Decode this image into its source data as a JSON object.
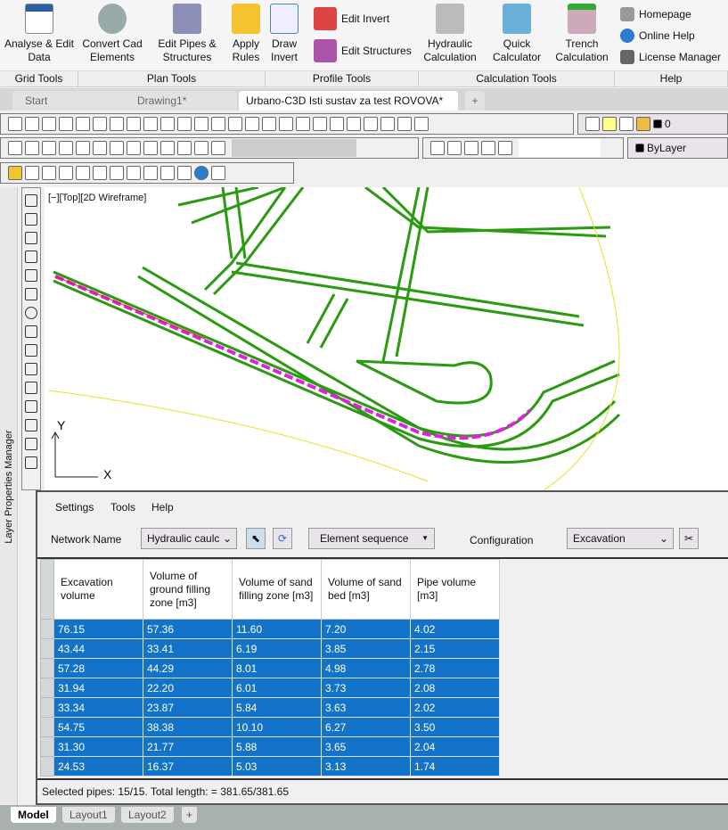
{
  "ribbon": {
    "buttons": [
      {
        "label": "Analyse & Edit Data",
        "icon": "grid-edit-icon"
      },
      {
        "label": "Convert Cad Elements",
        "icon": "pipe-convert-icon"
      },
      {
        "label": "Edit Pipes & Structures",
        "icon": "toolbox-icon"
      },
      {
        "label": "Apply Rules",
        "icon": "rules-lightning-icon"
      },
      {
        "label": "Draw Invert",
        "icon": "draw-invert-icon"
      },
      {
        "label": "Hydraulic Calculation",
        "icon": "hydraulic-icon"
      },
      {
        "label": "Quick Calculator",
        "icon": "calculator-icon"
      },
      {
        "label": "Trench Calculation",
        "icon": "trench-icon"
      }
    ],
    "small": [
      {
        "label": "Edit Invert"
      },
      {
        "label": "Edit Structures"
      },
      {
        "label": "Homepage"
      },
      {
        "label": "Online Help"
      },
      {
        "label": "License Manager"
      }
    ],
    "groups": [
      "Grid Tools",
      "Plan Tools",
      "Profile Tools",
      "Calculation Tools",
      "Help"
    ]
  },
  "tabs": [
    {
      "label": "Start"
    },
    {
      "label": "Drawing1*"
    },
    {
      "label": "Urbano-C3D Isti sustav za test ROVOVA*"
    }
  ],
  "toolbar": {
    "layer": "0",
    "linetype": "ByLayer"
  },
  "viewport_label": "[−][Top][2D Wireframe]",
  "side_label": "Layer Properties Manager",
  "axis": {
    "x": "X",
    "y": "Y"
  },
  "panel": {
    "menu": [
      "Settings",
      "Tools",
      "Help"
    ],
    "network_label": "Network Name",
    "network_value": "Hydraulic caulc",
    "sequence": "Element sequence",
    "config_label": "Configuration",
    "config_value": "Excavation",
    "columns": [
      "Excavation volume",
      "Volume of ground filling zone [m3]",
      "Volume of sand filling zone [m3]",
      "Volume of sand bed [m3]",
      "Pipe volume [m3]"
    ],
    "rows": [
      [
        "76.15",
        "57.36",
        "11.60",
        "7.20",
        "4.02"
      ],
      [
        "43.44",
        "33.41",
        "6.19",
        "3.85",
        "2.15"
      ],
      [
        "57.28",
        "44.29",
        "8.01",
        "4.98",
        "2.78"
      ],
      [
        "31.94",
        "22.20",
        "6.01",
        "3.73",
        "2.08"
      ],
      [
        "33.34",
        "23.87",
        "5.84",
        "3.63",
        "2.02"
      ],
      [
        "54.75",
        "38.38",
        "10.10",
        "6.27",
        "3.50"
      ],
      [
        "31.30",
        "21.77",
        "5.88",
        "3.65",
        "2.04"
      ],
      [
        "24.53",
        "16.37",
        "5.03",
        "3.13",
        "1.74"
      ]
    ],
    "status": "Selected pipes: 15/15. Total length: = 381.65/381.65",
    "selection_color": "#1273c8"
  },
  "layout_tabs": [
    {
      "label": "Model"
    },
    {
      "label": "Layout1"
    },
    {
      "label": "Layout2"
    },
    {
      "label": "+"
    }
  ]
}
